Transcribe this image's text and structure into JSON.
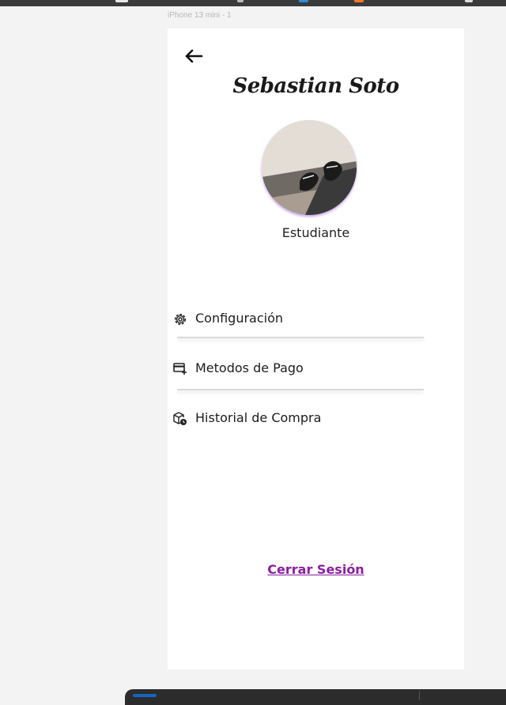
{
  "frame": {
    "label": "iPhone 13 mini - 1"
  },
  "header": {
    "back_icon": "arrow-left-icon"
  },
  "profile": {
    "name": "Sebastian Soto",
    "role": "Estudiante",
    "avatar_description": "photo-avatar"
  },
  "menu": {
    "items": [
      {
        "label": "Configuración",
        "icon": "gear-icon"
      },
      {
        "label": "Metodos de Pago",
        "icon": "credit-card-add-icon"
      },
      {
        "label": "Historial de Compra",
        "icon": "box-clock-icon"
      }
    ]
  },
  "footer": {
    "logout_label": "Cerrar Sesión"
  },
  "colors": {
    "background": "#f3f3f3",
    "screen": "#ffffff",
    "logout": "#8a1fa0",
    "avatar_glow": "#a35ae0",
    "topbar": "#3b3b3b"
  }
}
